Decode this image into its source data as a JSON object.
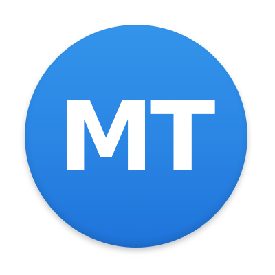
{
  "logo": {
    "text": "MT",
    "background_color": "#2b86e4",
    "text_color": "#ffffff"
  }
}
